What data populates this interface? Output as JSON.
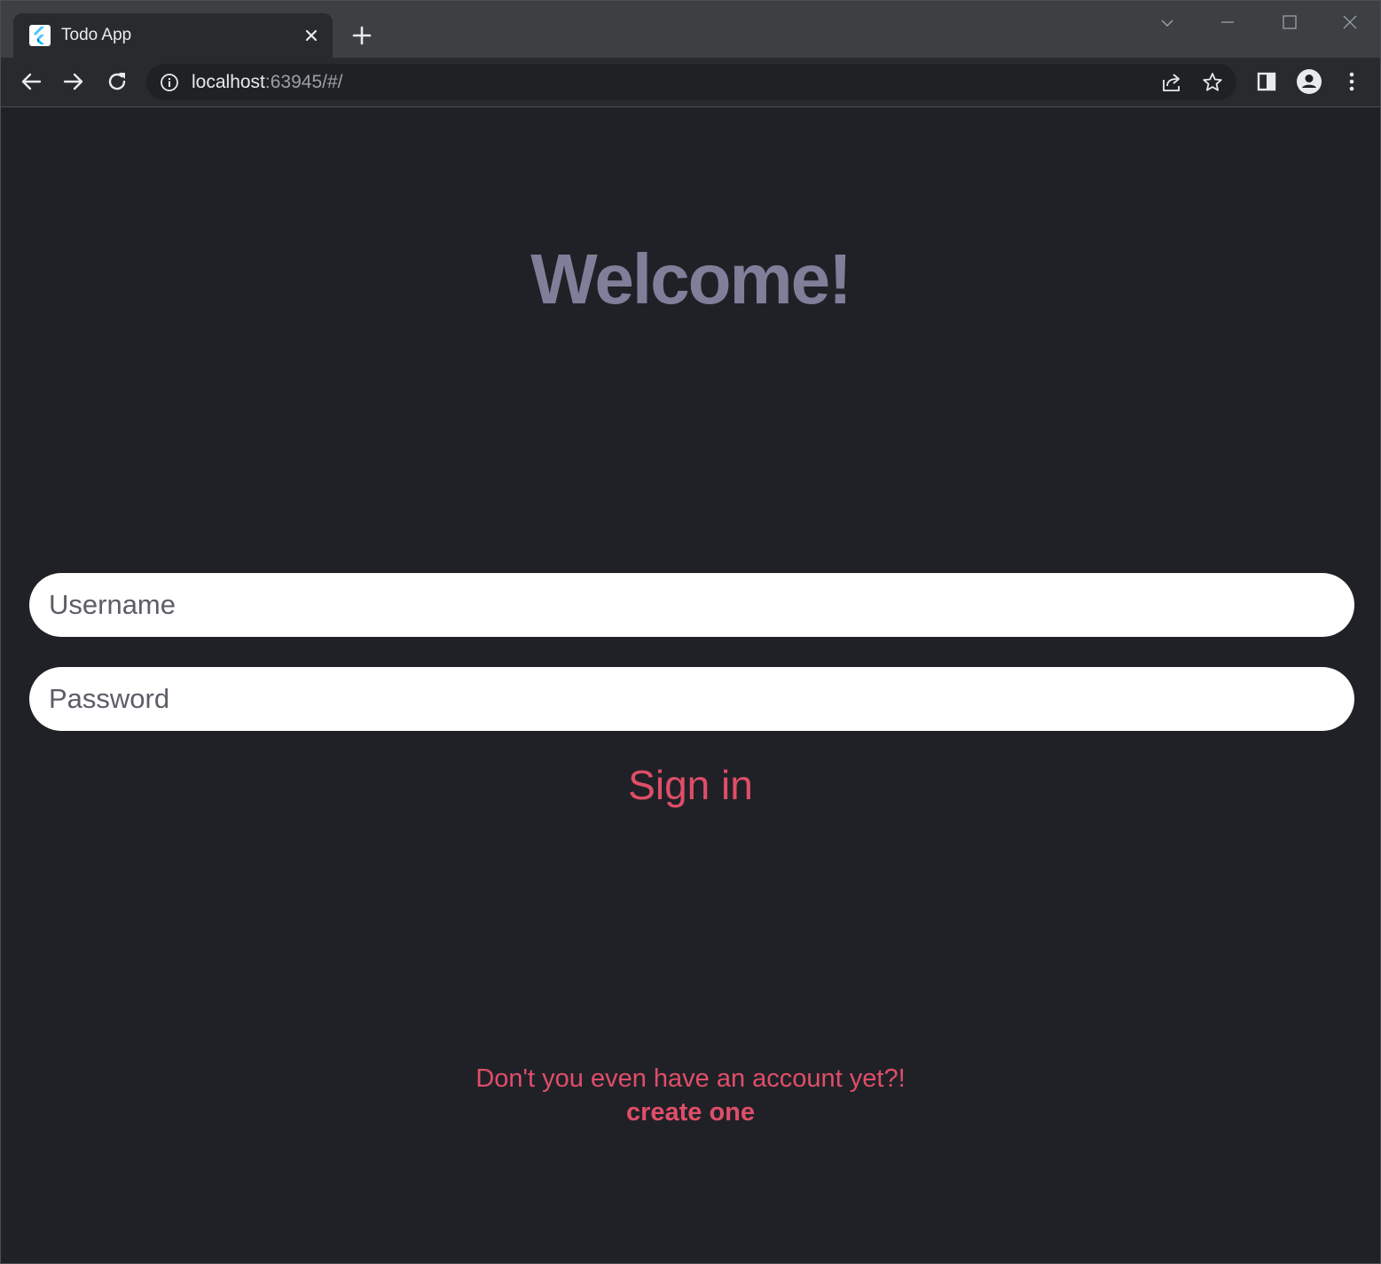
{
  "browser": {
    "tab": {
      "title": "Todo App",
      "favicon": "flutter-logo-icon",
      "close_icon": "close-icon"
    },
    "new_tab_icon": "plus-icon",
    "window_controls": [
      "tab-search-icon",
      "minimize-icon",
      "maximize-icon",
      "close-window-icon"
    ],
    "toolbar": {
      "back_icon": "back-arrow-icon",
      "forward_icon": "forward-arrow-icon",
      "reload_icon": "reload-icon",
      "site_info_icon": "info-icon",
      "url_host": "localhost",
      "url_rest": ":63945/#/",
      "share_icon": "share-icon",
      "bookmark_icon": "star-icon",
      "side_panel_icon": "side-panel-icon",
      "profile_icon": "profile-icon",
      "menu_icon": "kebab-menu-icon"
    }
  },
  "page": {
    "background": "#202127",
    "heading": "Welcome!",
    "heading_color": "#7f7f99",
    "accent_color": "#e04e68",
    "username": {
      "placeholder": "Username",
      "value": ""
    },
    "password": {
      "placeholder": "Password",
      "value": ""
    },
    "signin_label": "Sign in",
    "no_account_text": "Don't you even have an account yet?!",
    "create_link": "create one"
  }
}
